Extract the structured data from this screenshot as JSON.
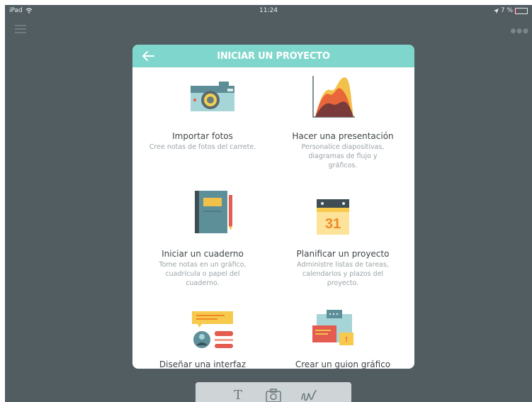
{
  "status": {
    "device": "iPad",
    "time": "11:24",
    "battery": "7 %",
    "battery_level": 0.07
  },
  "dialog": {
    "title": "INICIAR UN PROYECTO",
    "options": [
      {
        "title": "Importar fotos",
        "desc": "Cree notas de fotos del carrete.",
        "icon": "camera-icon"
      },
      {
        "title": "Hacer una presentación",
        "desc": "Personalice diapositivas, diagramas de flujo y gráficos.",
        "icon": "chart-icon"
      },
      {
        "title": "Iniciar un cuaderno",
        "desc": "Tome notas en un gráfico, cuadrícula o papel del cuaderno.",
        "icon": "notebook-icon"
      },
      {
        "title": "Planificar un proyecto",
        "desc": "Administre listas de tareas, calendarios y plazos del proyecto.",
        "icon": "calendar-icon"
      },
      {
        "title": "Diseñar una interfaz",
        "desc": "",
        "icon": "interface-icon"
      },
      {
        "title": "Crear un guion gráfico",
        "desc": "",
        "icon": "storyboard-icon"
      }
    ],
    "calendar_day": "31"
  },
  "toolbar": {
    "text_tool": "T",
    "tools": [
      "text-icon",
      "camera-icon",
      "draw-icon"
    ]
  }
}
